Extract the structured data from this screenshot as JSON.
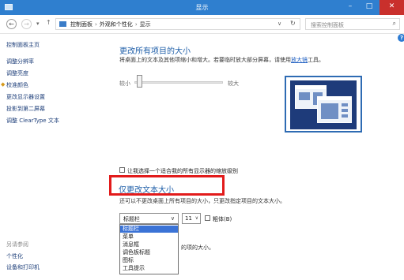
{
  "window": {
    "title": "显示",
    "minimize_glyph": "–",
    "maximize_glyph": "□",
    "close_glyph": "✕"
  },
  "nav": {
    "back_glyph": "←",
    "forward_glyph": "→",
    "recent_glyph": "▾",
    "up_glyph": "↑",
    "breadcrumbs": [
      "控制面板",
      "外观和个性化",
      "显示"
    ],
    "breadcrumb_separator": "›",
    "address_dropdown_glyph": "∨",
    "refresh_glyph": "↻",
    "search_placeholder": "搜索控制面板",
    "search_glyph": "⌕"
  },
  "sidebar": {
    "items": [
      {
        "label": "控制面板主页"
      },
      {
        "label": "调整分辨率"
      },
      {
        "label": "调整亮度"
      },
      {
        "label": "校准颜色",
        "icon": "shield-icon"
      },
      {
        "label": "更改显示器设置"
      },
      {
        "label": "投影到第二屏幕"
      },
      {
        "label": "调整 ClearType 文本"
      }
    ],
    "see_also_heading": "另请参阅",
    "see_also_items": [
      {
        "label": "个性化"
      },
      {
        "label": "设备和打印机"
      }
    ]
  },
  "help": {
    "glyph": "?"
  },
  "main": {
    "heading": "更改所有项目的大小",
    "description": "将桌面上的文本及其他项缩小和增大。若要临时放大部分屏幕，请使用",
    "description_link": "放大镜",
    "description_suffix": "工具。",
    "slider": {
      "min_label": "较小",
      "max_label": "较大",
      "value_fraction": 0.05
    },
    "custom_scaling_checkbox": {
      "label": "让我选择一个适合我的所有显示器的缩放级别",
      "checked": false
    }
  },
  "text_section": {
    "heading": "仅更改文本大小",
    "description": "还可以不更改桌面上所有项目的大小，只更改指定项目的文本大小。",
    "item_select": {
      "value": "标题栏",
      "arrow_glyph": "∨",
      "options": [
        "标题栏",
        "菜单",
        "消息框",
        "调色板标题",
        "图标",
        "工具提示"
      ],
      "selected_index": 0
    },
    "size_select": {
      "value": "11",
      "arrow_glyph": "∨"
    },
    "bold_checkbox": {
      "label": "粗体(B)",
      "checked": false
    },
    "partial_hidden_text": "的项的大小。"
  },
  "colors": {
    "titlebar": "#2f7fcf",
    "close_button": "#c9302c",
    "heading": "#1e5ea8",
    "highlight_box": "#e21b1b",
    "dropdown_selected": "#3b73d6"
  }
}
